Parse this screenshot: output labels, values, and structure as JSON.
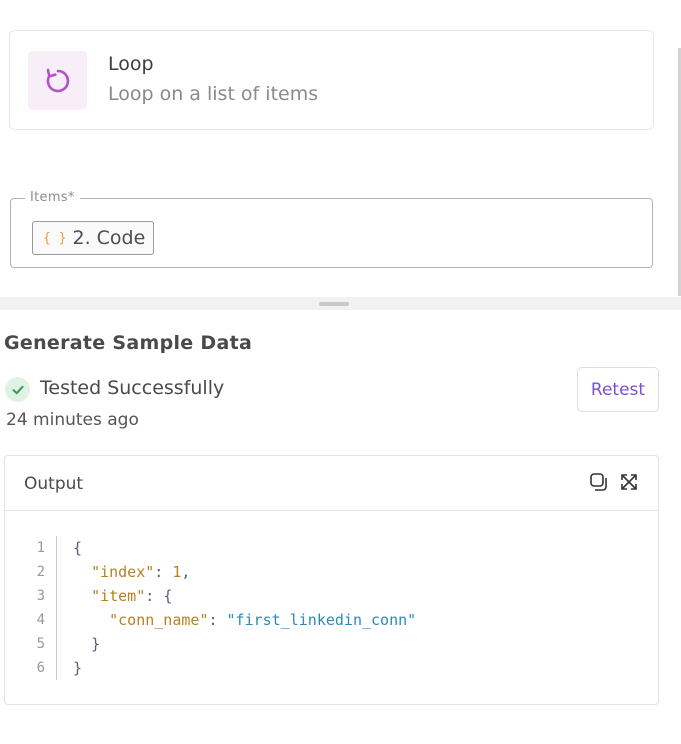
{
  "step": {
    "icon": "loop-icon",
    "title": "Loop",
    "subtitle": "Loop on a list of items",
    "icon_bg": "#f7eef7",
    "icon_color": "#b452c4"
  },
  "items_field": {
    "label": "Items*",
    "chip_icon": "{ }",
    "chip_label": "2. Code"
  },
  "sample": {
    "title": "Generate Sample Data",
    "status": "Tested Successfully",
    "status_icon": "check-icon",
    "time": "24 minutes ago",
    "retest_label": "Retest",
    "accent": "#7b4fd6",
    "success_color": "#2f9e4f"
  },
  "output": {
    "title": "Output",
    "icons": [
      "copy-icon",
      "expand-icon"
    ],
    "lines": [
      {
        "no": "1",
        "text": "{"
      },
      {
        "no": "2",
        "key": "\"index\"",
        "sep": ": ",
        "num": "1",
        "tail": ","
      },
      {
        "no": "3",
        "key": "\"item\"",
        "sep": ": ",
        "tail": "{"
      },
      {
        "no": "4",
        "key": "\"conn_name\"",
        "sep": ": ",
        "str": "\"first_linkedin_conn\""
      },
      {
        "no": "5",
        "text": "}"
      },
      {
        "no": "6",
        "text": "}"
      }
    ]
  }
}
